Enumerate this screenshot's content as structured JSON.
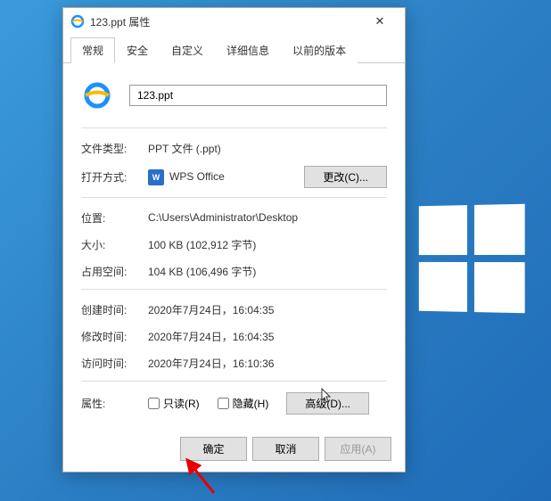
{
  "window": {
    "title": "123.ppt 属性"
  },
  "tabs": [
    "常规",
    "安全",
    "自定义",
    "详细信息",
    "以前的版本"
  ],
  "file": {
    "name": "123.ppt"
  },
  "fields": {
    "filetype_label": "文件类型:",
    "filetype_value": "PPT 文件 (.ppt)",
    "openwith_label": "打开方式:",
    "openwith_value": "WPS Office",
    "change_btn": "更改(C)...",
    "location_label": "位置:",
    "location_value": "C:\\Users\\Administrator\\Desktop",
    "size_label": "大小:",
    "size_value": "100 KB (102,912 字节)",
    "diskspace_label": "占用空间:",
    "diskspace_value": "104 KB (106,496 字节)",
    "created_label": "创建时间:",
    "created_value": "2020年7月24日，16:04:35",
    "modified_label": "修改时间:",
    "modified_value": "2020年7月24日，16:04:35",
    "accessed_label": "访问时间:",
    "accessed_value": "2020年7月24日，16:10:36",
    "attrs_label": "属性:",
    "readonly_label": "只读(R)",
    "hidden_label": "隐藏(H)",
    "advanced_btn": "高级(D)..."
  },
  "buttons": {
    "ok": "确定",
    "cancel": "取消",
    "apply": "应用(A)"
  }
}
